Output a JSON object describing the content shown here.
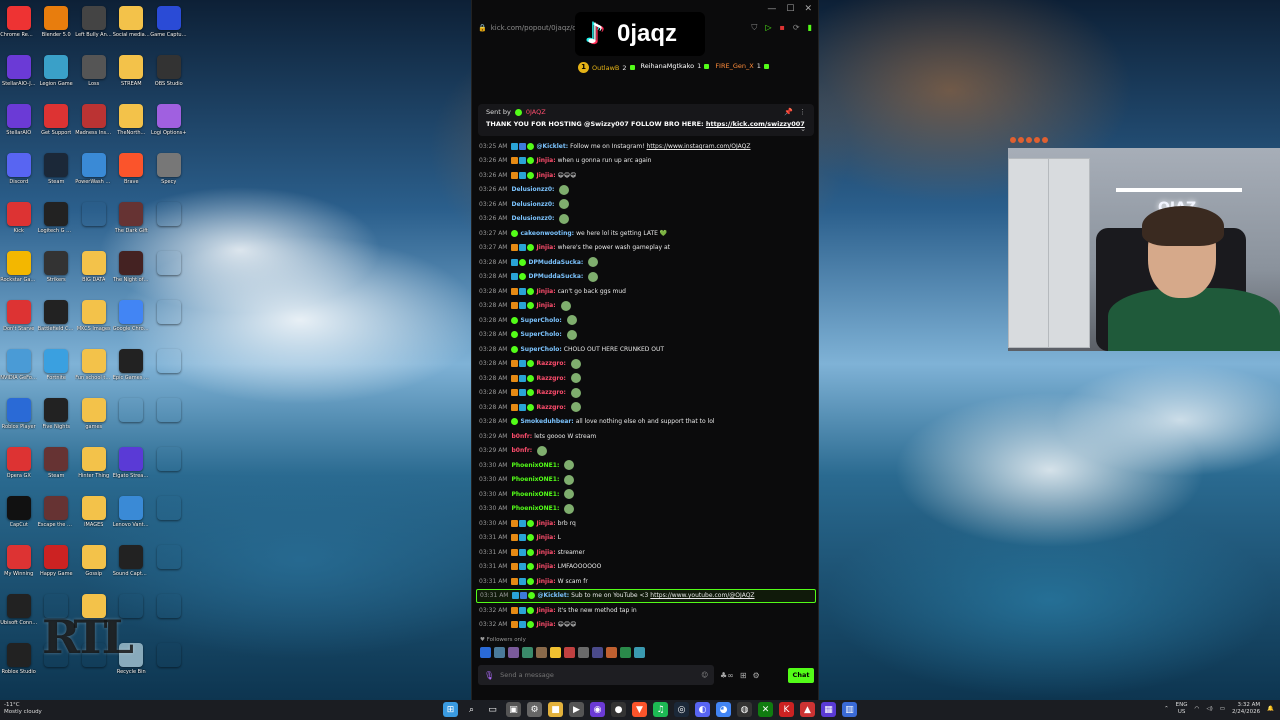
{
  "desktop": {
    "icons": [
      {
        "label": "Chrome Remo...",
        "color": "#e33"
      },
      {
        "label": "Blender 5.0",
        "color": "#e87d0d"
      },
      {
        "label": "Left Bully Angels",
        "color": "#444"
      },
      {
        "label": "Social media stuff",
        "color": "#f3c24a"
      },
      {
        "label": "Game Capture HD",
        "color": "#2a4bd6"
      },
      {
        "label": "StellarAIO-J...",
        "color": "#6b3ad6"
      },
      {
        "label": "Legion Game",
        "color": "#3aa0c8"
      },
      {
        "label": "Loss",
        "color": "#555"
      },
      {
        "label": "STREAM",
        "color": "#f3c24a"
      },
      {
        "label": "OBS Studio",
        "color": "#333"
      },
      {
        "label": "StellarAIO",
        "color": "#6b3ad6"
      },
      {
        "label": "Get Support",
        "color": "#d33"
      },
      {
        "label": "Madness Inside",
        "color": "#b33"
      },
      {
        "label": "TheNorth...",
        "color": "#f3c24a"
      },
      {
        "label": "Logi Options+",
        "color": "#a060e0"
      },
      {
        "label": "Discord",
        "color": "#5865f2"
      },
      {
        "label": "Steam",
        "color": "#1b2838"
      },
      {
        "label": "PowerWash Simulator 2",
        "color": "#3a8ad6"
      },
      {
        "label": "Brave",
        "color": "#fb542b"
      },
      {
        "label": "Specy",
        "color": "#777"
      },
      {
        "label": "Kick",
        "color": "#d33"
      },
      {
        "label": "Logitech G HUB",
        "color": "#222"
      },
      {
        "label": "",
        "color": "rgba(0,0,0,0)"
      },
      {
        "label": "The Dark Gift",
        "color": "#633"
      },
      {
        "label": "",
        "color": "rgba(0,0,0,0)"
      },
      {
        "label": "Rockstar Games",
        "color": "#f3b700"
      },
      {
        "label": "Strikers",
        "color": "#333"
      },
      {
        "label": "BIG DATA",
        "color": "#f3c24a"
      },
      {
        "label": "The Night of the Shadows",
        "color": "#422"
      },
      {
        "label": "",
        "color": "rgba(0,0,0,0)"
      },
      {
        "label": "Don't Starve",
        "color": "#d33"
      },
      {
        "label": "Battlefield Cursor",
        "color": "#222"
      },
      {
        "label": "MKCS Images",
        "color": "#f3c24a"
      },
      {
        "label": "Google Chrome",
        "color": "#4285f4"
      },
      {
        "label": "",
        "color": "rgba(0,0,0,0)"
      },
      {
        "label": "NVIDIA GeForce",
        "color": "#4a9bd6"
      },
      {
        "label": "Fortnite",
        "color": "#3aa0e0"
      },
      {
        "label": "Fun school things",
        "color": "#f3c24a"
      },
      {
        "label": "Epic Games Launcher",
        "color": "#222"
      },
      {
        "label": "",
        "color": "rgba(0,0,0,0)"
      },
      {
        "label": "Roblox Player",
        "color": "#2a6ad6"
      },
      {
        "label": "Five Nights",
        "color": "#222"
      },
      {
        "label": "games",
        "color": "#f3c24a"
      },
      {
        "label": "",
        "color": "rgba(0,0,0,0)"
      },
      {
        "label": "",
        "color": "rgba(0,0,0,0)"
      },
      {
        "label": "Opera GX",
        "color": "#d33"
      },
      {
        "label": "Steam",
        "color": "#633"
      },
      {
        "label": "Hinter Thing",
        "color": "#f3c24a"
      },
      {
        "label": "Elgato Stream Deck",
        "color": "#5a3ad6"
      },
      {
        "label": "",
        "color": "rgba(0,0,0,0)"
      },
      {
        "label": "CapCut",
        "color": "#111"
      },
      {
        "label": "Escape the Backrooms",
        "color": "#633"
      },
      {
        "label": "IMAGES",
        "color": "#f3c24a"
      },
      {
        "label": "Lenovo Vantage",
        "color": "#3a8ad6"
      },
      {
        "label": "",
        "color": "rgba(0,0,0,0)"
      },
      {
        "label": "My Winning",
        "color": "#d33"
      },
      {
        "label": "Happy Game",
        "color": "#c22"
      },
      {
        "label": "Gossip",
        "color": "#f3c24a"
      },
      {
        "label": "Sound Capture",
        "color": "#222"
      },
      {
        "label": "",
        "color": "rgba(0,0,0,0)"
      },
      {
        "label": "Ubisoft Connect",
        "color": "#222"
      },
      {
        "label": "",
        "color": "rgba(0,0,0,0)"
      },
      {
        "label": "",
        "color": "#f3c24a"
      },
      {
        "label": "",
        "color": "rgba(0,0,0,0)"
      },
      {
        "label": "",
        "color": "rgba(0,0,0,0)"
      },
      {
        "label": "Roblox Studio",
        "color": "#222"
      },
      {
        "label": "",
        "color": "rgba(0,0,0,0)"
      },
      {
        "label": "",
        "color": "rgba(0,0,0,0)"
      },
      {
        "label": "Recycle Bin",
        "color": "#8ab"
      },
      {
        "label": "",
        "color": "rgba(0,0,0,0)"
      }
    ]
  },
  "browser": {
    "url": "kick.com/popout/0jaqz/cha",
    "lock": "🔒"
  },
  "overlay": {
    "tiktok_name": "0jaqz",
    "leaderboard": [
      {
        "rank": "1",
        "name": "OutlawB",
        "count": "2",
        "color": "#e5b316"
      },
      {
        "rank": "",
        "name": "ReihanaMgtkako",
        "count": "1",
        "color": "#ffffff"
      },
      {
        "rank": "",
        "name": "FIRE_Gen_X",
        "count": "1",
        "color": "#ff8c3a"
      }
    ]
  },
  "pinned": {
    "sent_by_label": "Sent by",
    "sent_by_user": "0JAQZ",
    "message": "THANK YOU FOR HOSTING @Swizzy007 FOLLOW BRO HERE:",
    "link": "https://kick.com/swizzy007"
  },
  "messages": [
    {
      "time": "03:25 AM",
      "badges": [
        "sub",
        "mod",
        "vip"
      ],
      "user": "@Kicklet:",
      "color": "#7cc4ff",
      "text": "Follow me on Instagram!",
      "link": "https://www.instagram.com/OJAQZ",
      "emote": false,
      "highlight": false
    },
    {
      "time": "03:26 AM",
      "badges": [
        "og",
        "sub",
        "vip"
      ],
      "user": "Jinjia:",
      "color": "#ff4d6d",
      "text": "when u gonna run up arc again",
      "link": "",
      "emote": false,
      "highlight": false
    },
    {
      "time": "03:26 AM",
      "badges": [
        "og",
        "sub",
        "vip"
      ],
      "user": "Jinjia:",
      "color": "#ff4d6d",
      "text": "😄😄😄",
      "link": "",
      "emote": false,
      "highlight": false
    },
    {
      "time": "03:26 AM",
      "badges": [],
      "user": "Delusionzz0:",
      "color": "#7cc4ff",
      "text": "",
      "link": "",
      "emote": true,
      "highlight": false
    },
    {
      "time": "03:26 AM",
      "badges": [],
      "user": "Delusionzz0:",
      "color": "#7cc4ff",
      "text": "",
      "link": "",
      "emote": true,
      "highlight": false
    },
    {
      "time": "03:26 AM",
      "badges": [],
      "user": "Delusionzz0:",
      "color": "#7cc4ff",
      "text": "",
      "link": "",
      "emote": true,
      "highlight": false
    },
    {
      "time": "03:27 AM",
      "badges": [
        "vip"
      ],
      "user": "cakeonwooting:",
      "color": "#7cc4ff",
      "text": "we here lol its getting LATE 💚",
      "link": "",
      "emote": false,
      "highlight": false
    },
    {
      "time": "03:27 AM",
      "badges": [
        "og",
        "sub",
        "vip"
      ],
      "user": "Jinjia:",
      "color": "#ff4d6d",
      "text": "where's the power wash gameplay at",
      "link": "",
      "emote": false,
      "highlight": false
    },
    {
      "time": "03:28 AM",
      "badges": [
        "sub",
        "vip"
      ],
      "user": "DPMuddaSucka:",
      "color": "#7cc4ff",
      "text": "",
      "link": "",
      "emote": true,
      "highlight": false
    },
    {
      "time": "03:28 AM",
      "badges": [
        "sub",
        "vip"
      ],
      "user": "DPMuddaSucka:",
      "color": "#7cc4ff",
      "text": "",
      "link": "",
      "emote": true,
      "highlight": false
    },
    {
      "time": "03:28 AM",
      "badges": [
        "og",
        "sub",
        "vip"
      ],
      "user": "Jinjia:",
      "color": "#ff4d6d",
      "text": "can't go back ggs mud",
      "link": "",
      "emote": false,
      "highlight": false
    },
    {
      "time": "03:28 AM",
      "badges": [
        "og",
        "sub",
        "vip"
      ],
      "user": "Jinjia:",
      "color": "#ff4d6d",
      "text": "",
      "link": "",
      "emote": true,
      "highlight": false
    },
    {
      "time": "03:28 AM",
      "badges": [
        "vip"
      ],
      "user": "SuperCholo:",
      "color": "#7cc4ff",
      "text": "",
      "link": "",
      "emote": true,
      "highlight": false
    },
    {
      "time": "03:28 AM",
      "badges": [
        "vip"
      ],
      "user": "SuperCholo:",
      "color": "#7cc4ff",
      "text": "",
      "link": "",
      "emote": true,
      "highlight": false
    },
    {
      "time": "03:28 AM",
      "badges": [
        "vip"
      ],
      "user": "SuperCholo:",
      "color": "#7cc4ff",
      "text": "CHOLO OUT HERE CRUNKED OUT",
      "link": "",
      "emote": false,
      "highlight": false
    },
    {
      "time": "03:28 AM",
      "badges": [
        "og",
        "sub",
        "vip"
      ],
      "user": "Razzgro:",
      "color": "#ff4d6d",
      "text": "",
      "link": "",
      "emote": true,
      "highlight": false
    },
    {
      "time": "03:28 AM",
      "badges": [
        "og",
        "sub",
        "vip"
      ],
      "user": "Razzgro:",
      "color": "#ff4d6d",
      "text": "",
      "link": "",
      "emote": true,
      "highlight": false
    },
    {
      "time": "03:28 AM",
      "badges": [
        "og",
        "sub",
        "vip"
      ],
      "user": "Razzgro:",
      "color": "#ff4d6d",
      "text": "",
      "link": "",
      "emote": true,
      "highlight": false
    },
    {
      "time": "03:28 AM",
      "badges": [
        "og",
        "sub",
        "vip"
      ],
      "user": "Razzgro:",
      "color": "#ff4d6d",
      "text": "",
      "link": "",
      "emote": true,
      "highlight": false
    },
    {
      "time": "03:28 AM",
      "badges": [
        "vip"
      ],
      "user": "Smokeduhbear:",
      "color": "#7cc4ff",
      "text": "all love nothing else oh and support that to lol",
      "link": "",
      "emote": false,
      "highlight": false
    },
    {
      "time": "03:29 AM",
      "badges": [],
      "user": "b0nfr:",
      "color": "#ff4d6d",
      "text": "lets goooo W stream",
      "link": "",
      "emote": false,
      "highlight": false
    },
    {
      "time": "03:29 AM",
      "badges": [],
      "user": "b0nfr:",
      "color": "#ff4d6d",
      "text": "",
      "link": "",
      "emote": true,
      "highlight": false
    },
    {
      "time": "03:30 AM",
      "badges": [],
      "user": "PhoenixONE1:",
      "color": "#53fc18",
      "text": "",
      "link": "",
      "emote": true,
      "highlight": false
    },
    {
      "time": "03:30 AM",
      "badges": [],
      "user": "PhoenixONE1:",
      "color": "#53fc18",
      "text": "",
      "link": "",
      "emote": true,
      "highlight": false
    },
    {
      "time": "03:30 AM",
      "badges": [],
      "user": "PhoenixONE1:",
      "color": "#53fc18",
      "text": "",
      "link": "",
      "emote": true,
      "highlight": false
    },
    {
      "time": "03:30 AM",
      "badges": [],
      "user": "PhoenixONE1:",
      "color": "#53fc18",
      "text": "",
      "link": "",
      "emote": true,
      "highlight": false
    },
    {
      "time": "03:30 AM",
      "badges": [
        "og",
        "sub",
        "vip"
      ],
      "user": "Jinjia:",
      "color": "#ff4d6d",
      "text": "brb rq",
      "link": "",
      "emote": false,
      "highlight": false
    },
    {
      "time": "03:31 AM",
      "badges": [
        "og",
        "sub",
        "vip"
      ],
      "user": "Jinjia:",
      "color": "#ff4d6d",
      "text": "L",
      "link": "",
      "emote": false,
      "highlight": false
    },
    {
      "time": "03:31 AM",
      "badges": [
        "og",
        "sub",
        "vip"
      ],
      "user": "Jinjia:",
      "color": "#ff4d6d",
      "text": "streamer",
      "link": "",
      "emote": false,
      "highlight": false
    },
    {
      "time": "03:31 AM",
      "badges": [
        "og",
        "sub",
        "vip"
      ],
      "user": "Jinjia:",
      "color": "#ff4d6d",
      "text": "LMFAOOOOOO",
      "link": "",
      "emote": false,
      "highlight": false
    },
    {
      "time": "03:31 AM",
      "badges": [
        "og",
        "sub",
        "vip"
      ],
      "user": "Jinjia:",
      "color": "#ff4d6d",
      "text": "W scam fr",
      "link": "",
      "emote": false,
      "highlight": false
    },
    {
      "time": "03:31 AM",
      "badges": [
        "sub",
        "mod",
        "vip"
      ],
      "user": "@Kicklet:",
      "color": "#7cc4ff",
      "text": "Sub to me on YouTube <3",
      "link": "https://www.youtube.com/@OJAQZ",
      "emote": false,
      "highlight": true
    },
    {
      "time": "03:32 AM",
      "badges": [
        "og",
        "sub",
        "vip"
      ],
      "user": "Jinjia:",
      "color": "#ff4d6d",
      "text": "it's the new method tap in",
      "link": "",
      "emote": false,
      "highlight": false
    },
    {
      "time": "03:32 AM",
      "badges": [
        "og",
        "sub",
        "vip"
      ],
      "user": "Jinjia:",
      "color": "#ff4d6d",
      "text": "😄😄😄",
      "link": "",
      "emote": false,
      "highlight": false
    }
  ],
  "followers_only": "♥ Followers only",
  "emote_bar": [
    "#2a6ad6",
    "#4a7a9a",
    "#7a5a9a",
    "#3a8a6a",
    "#8a6a4a",
    "#f0c030",
    "#c04040",
    "#6a6a6a",
    "#4a4a8a",
    "#c06030",
    "#2a8a4a",
    "#3a9ab0"
  ],
  "input": {
    "placeholder": "Send a message",
    "chat_button": "Chat"
  },
  "taskbar": {
    "weather_temp": "-11°C",
    "weather_desc": "Mostly cloudy",
    "lang_top": "ENG",
    "lang_bottom": "US",
    "time": "3:32 AM",
    "date": "2/24/2026",
    "apps": [
      {
        "name": "start-icon",
        "glyph": "⊞",
        "color": "#3a9ae0"
      },
      {
        "name": "search-icon",
        "glyph": "⌕",
        "color": "rgba(0,0,0,0)"
      },
      {
        "name": "task-view-icon",
        "glyph": "▭",
        "color": "rgba(0,0,0,0)"
      },
      {
        "name": "app-icon",
        "glyph": "▣",
        "color": "#555"
      },
      {
        "name": "settings-icon",
        "glyph": "⚙",
        "color": "#666"
      },
      {
        "name": "folder-icon",
        "glyph": "■",
        "color": "#e3b23c"
      },
      {
        "name": "media-icon",
        "glyph": "▶",
        "color": "#555"
      },
      {
        "name": "stellar-icon",
        "glyph": "◉",
        "color": "#6b3ad6"
      },
      {
        "name": "obs-icon",
        "glyph": "●",
        "color": "#333"
      },
      {
        "name": "brave-icon",
        "glyph": "▼",
        "color": "#fb542b"
      },
      {
        "name": "spotify-icon",
        "glyph": "♫",
        "color": "#1db954"
      },
      {
        "name": "steam-icon",
        "glyph": "◎",
        "color": "#1b2838"
      },
      {
        "name": "discord-icon",
        "glyph": "◐",
        "color": "#5865f2"
      },
      {
        "name": "chrome-icon",
        "glyph": "◕",
        "color": "#4285f4"
      },
      {
        "name": "camera-icon",
        "glyph": "◍",
        "color": "#333"
      },
      {
        "name": "xbox-icon",
        "glyph": "✕",
        "color": "#107c10"
      },
      {
        "name": "kick-icon",
        "glyph": "K",
        "color": "#c22"
      },
      {
        "name": "red-app-icon",
        "glyph": "▲",
        "color": "#c33"
      },
      {
        "name": "streamdeck-icon",
        "glyph": "▦",
        "color": "#5a3ad6"
      },
      {
        "name": "blue-app-icon",
        "glyph": "▥",
        "color": "#3a6ad6"
      }
    ]
  }
}
